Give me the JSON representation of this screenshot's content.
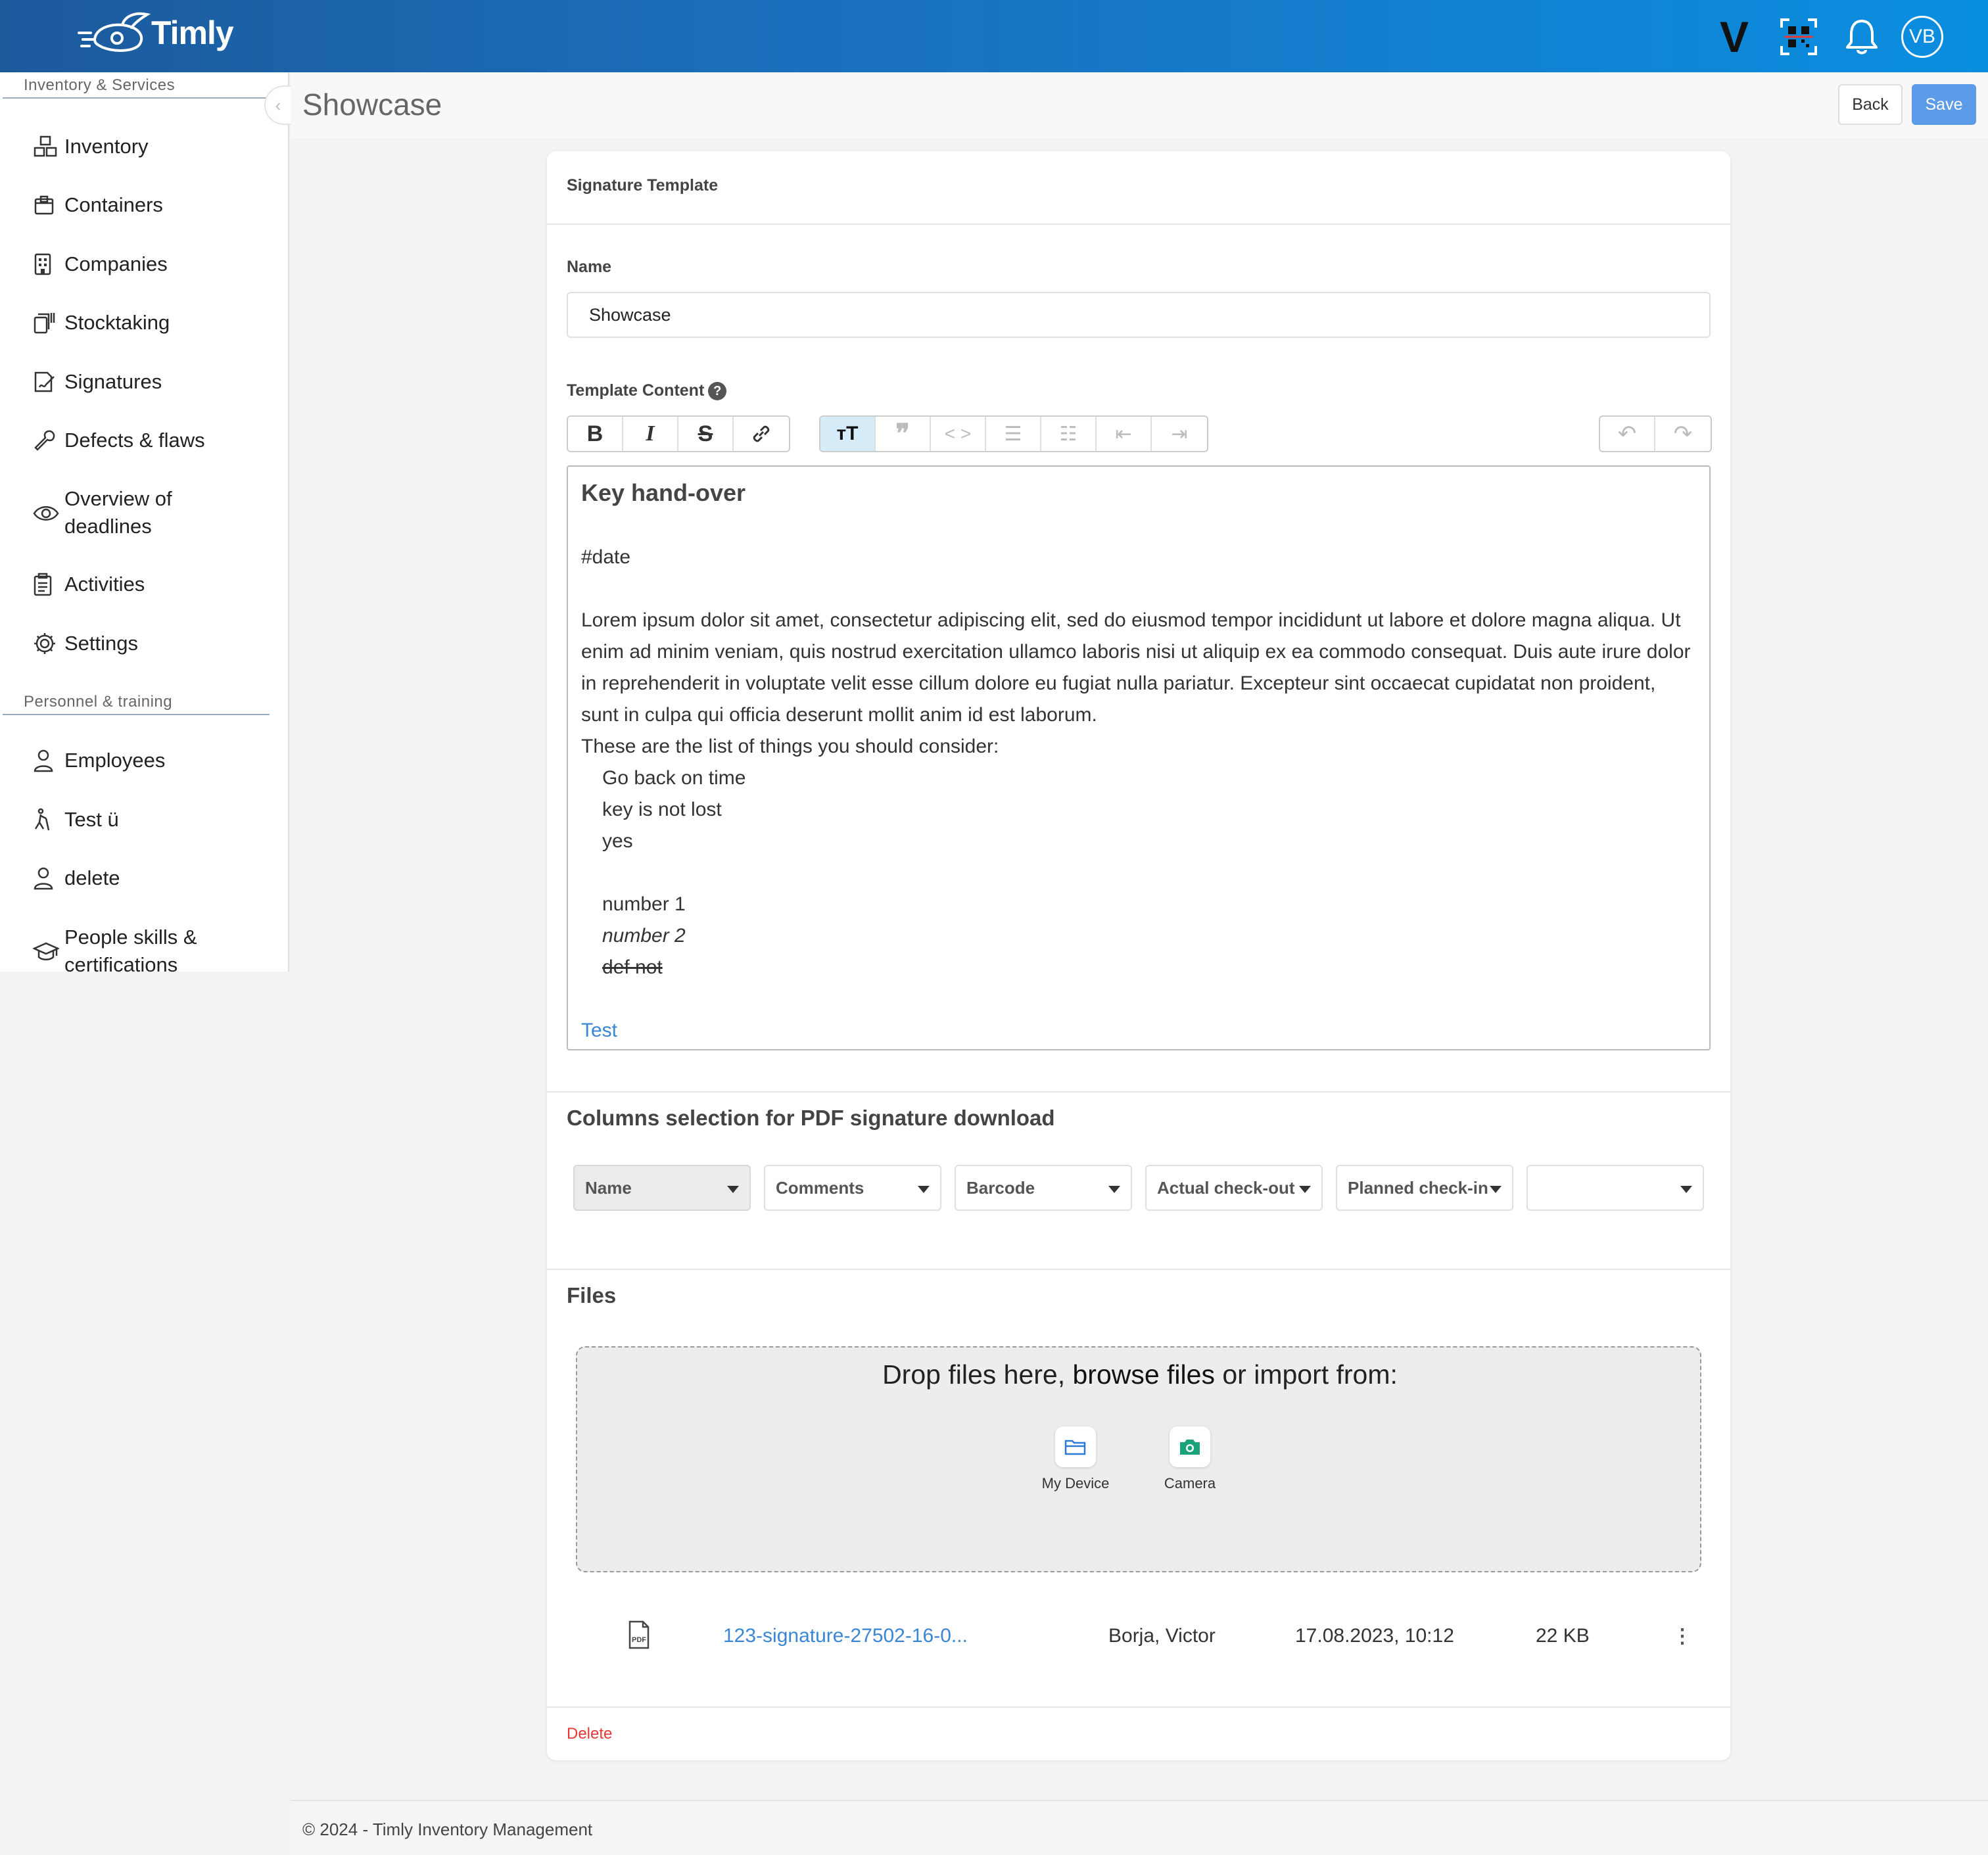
{
  "app": {
    "logo_text": "Timly",
    "top_letter": "V",
    "avatar_initials": "VB",
    "top_icons": [
      "qr-scan-icon",
      "bell-icon"
    ]
  },
  "sidebar": {
    "section1": "Inventory & Services",
    "section2": "Personnel & training",
    "items": [
      {
        "label": "Inventory",
        "icon": "boxes-icon"
      },
      {
        "label": "Containers",
        "icon": "container-icon"
      },
      {
        "label": "Companies",
        "icon": "building-icon"
      },
      {
        "label": "Stocktaking",
        "icon": "stocktaking-icon"
      },
      {
        "label": "Signatures",
        "icon": "signature-icon"
      },
      {
        "label": "Defects & flaws",
        "icon": "wrench-icon"
      },
      {
        "label": "Overview of deadlines",
        "icon": "eye-icon"
      },
      {
        "label": "Activities",
        "icon": "clipboard-icon"
      },
      {
        "label": "Settings",
        "icon": "gear-icon"
      },
      {
        "label": "Employees",
        "icon": "person-icon"
      },
      {
        "label": "Test ü",
        "icon": "person-walking-icon"
      },
      {
        "label": "delete",
        "icon": "person-icon"
      },
      {
        "label": "People skills & certifications",
        "icon": "graduation-cap-icon"
      }
    ]
  },
  "header": {
    "title": "Showcase",
    "back_label": "Back",
    "save_label": "Save"
  },
  "card": {
    "title": "Signature Template",
    "name_label": "Name",
    "name_value": "Showcase",
    "content_label": "Template Content",
    "editor": {
      "heading": "Key hand-over",
      "date_tag": "#date",
      "paragraph": "Lorem ipsum dolor sit amet, consectetur adipiscing elit, sed do eiusmod tempor incididunt ut labore et dolore magna aliqua. Ut enim ad minim veniam, quis nostrud exercitation ullamco laboris nisi ut aliquip ex ea commodo consequat. Duis aute irure dolor in reprehenderit in voluptate velit esse cillum dolore eu fugiat nulla pariatur. Excepteur sint occaecat cupidatat non proident, sunt in culpa qui officia deserunt mollit anim id est laborum.",
      "list_intro": "These are the list of things you should consider:",
      "list1": [
        "Go back on time",
        "key is not lost",
        "yes"
      ],
      "list2": [
        "number 1",
        "number 2",
        "def not"
      ],
      "link_text": "Test"
    },
    "columns_heading": "Columns selection for PDF signature download",
    "columns": [
      "Name",
      "Comments",
      "Barcode",
      "Actual check-out",
      "Planned check-in",
      ""
    ],
    "files_heading": "Files",
    "dropzone": {
      "text_before": "Drop files here, ",
      "browse": "browse files",
      "text_after": " or import from:",
      "sources": [
        "My Device",
        "Camera"
      ]
    },
    "file": {
      "name": "123-signature-27502-16-0...",
      "owner": "Borja, Victor",
      "date": "17.08.2023, 10:12",
      "size": "22 KB"
    },
    "delete_label": "Delete"
  },
  "footer": {
    "text": "© 2024 - Timly Inventory Management"
  },
  "colors": {
    "primary": "#5b9be8",
    "link": "#3a86d4",
    "danger": "#e53935",
    "topbar_start": "#1c5a9c",
    "topbar_end": "#0a8ee0"
  }
}
